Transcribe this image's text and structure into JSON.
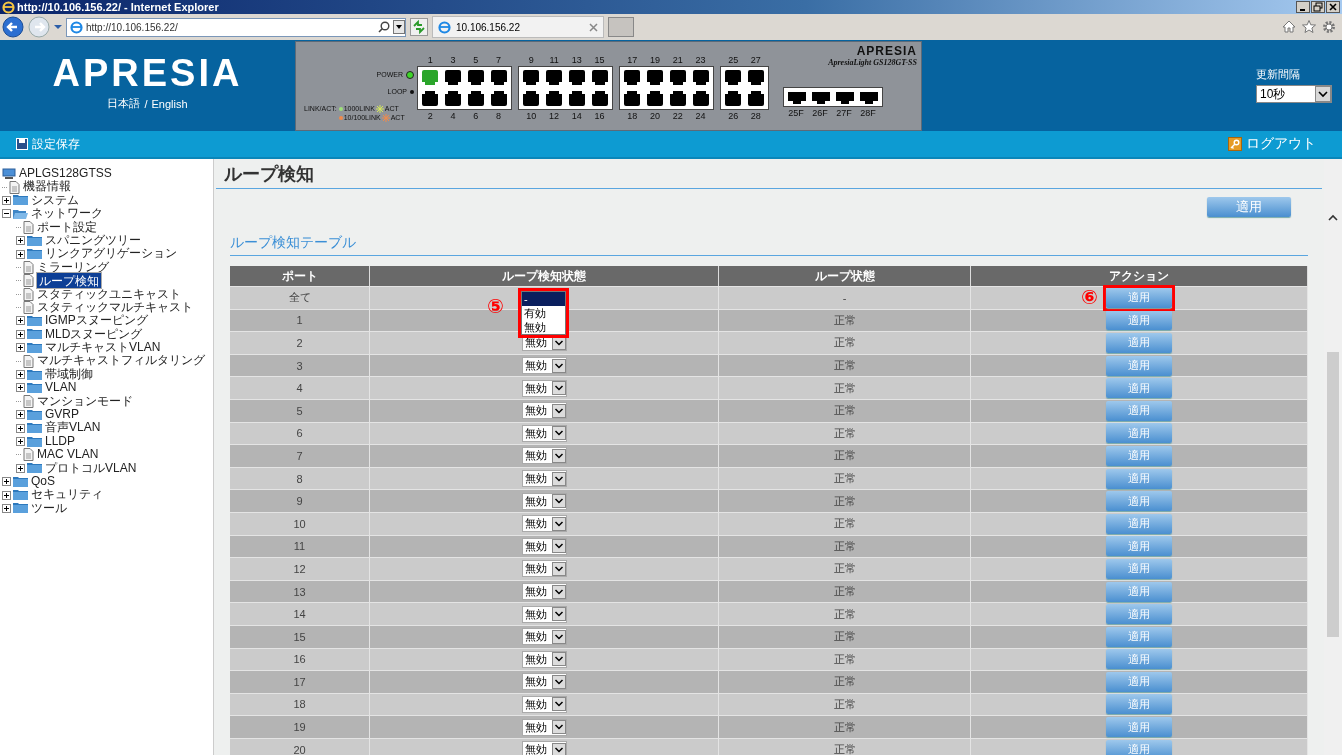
{
  "browser": {
    "title": "http://10.106.156.22/ - Internet Explorer",
    "address": "http://10.106.156.22/",
    "tab_title": "10.106.156.22"
  },
  "header": {
    "logo": "APRESIA",
    "languages": [
      "日本語",
      "English"
    ],
    "separator": "/",
    "switch": {
      "brand": "APRESIA",
      "model": "ApresiaLight GS128GT-SS",
      "leds": [
        {
          "label": "POWER",
          "color": "#3fd62a"
        },
        {
          "label": "LOOP",
          "color": "#111111"
        }
      ],
      "legend_title": "LINK/ACT:",
      "legend_rows": [
        [
          {
            "label": "1000LINK",
            "kind": "dot",
            "color": "#9ee27a"
          },
          {
            "label": "ACT",
            "kind": "burst",
            "color": "#d6e85a"
          }
        ],
        [
          {
            "label": "10/100LINK",
            "kind": "dot",
            "color": "#f08a4b"
          },
          {
            "label": "ACT",
            "kind": "burst",
            "color": "#f08a4b"
          }
        ]
      ],
      "port_groups": [
        {
          "columns": [
            {
              "upper": {
                "label": "1",
                "linked": true
              },
              "lower": {
                "label": "2",
                "linked": false
              }
            },
            {
              "upper": {
                "label": "3",
                "linked": false
              },
              "lower": {
                "label": "4",
                "linked": false
              }
            },
            {
              "upper": {
                "label": "5",
                "linked": false
              },
              "lower": {
                "label": "6",
                "linked": false
              }
            },
            {
              "upper": {
                "label": "7",
                "linked": false
              },
              "lower": {
                "label": "8",
                "linked": false
              }
            }
          ]
        },
        {
          "columns": [
            {
              "upper": {
                "label": "9",
                "linked": false
              },
              "lower": {
                "label": "10",
                "linked": false
              }
            },
            {
              "upper": {
                "label": "11",
                "linked": false
              },
              "lower": {
                "label": "12",
                "linked": false
              }
            },
            {
              "upper": {
                "label": "13",
                "linked": false
              },
              "lower": {
                "label": "14",
                "linked": false
              }
            },
            {
              "upper": {
                "label": "15",
                "linked": false
              },
              "lower": {
                "label": "16",
                "linked": false
              }
            }
          ]
        },
        {
          "columns": [
            {
              "upper": {
                "label": "17",
                "linked": false
              },
              "lower": {
                "label": "18",
                "linked": false
              }
            },
            {
              "upper": {
                "label": "19",
                "linked": false
              },
              "lower": {
                "label": "20",
                "linked": false
              }
            },
            {
              "upper": {
                "label": "21",
                "linked": false
              },
              "lower": {
                "label": "22",
                "linked": false
              }
            },
            {
              "upper": {
                "label": "23",
                "linked": false
              },
              "lower": {
                "label": "24",
                "linked": false
              }
            }
          ]
        },
        {
          "columns": [
            {
              "upper": {
                "label": "25",
                "linked": false
              },
              "lower": {
                "label": "26",
                "linked": false
              }
            },
            {
              "upper": {
                "label": "27",
                "linked": false
              },
              "lower": {
                "label": "28",
                "linked": false
              }
            }
          ]
        }
      ],
      "sfp_ports": [
        {
          "label": "25F",
          "linked": false
        },
        {
          "label": "26F",
          "linked": false
        },
        {
          "label": "27F",
          "linked": false
        },
        {
          "label": "28F",
          "linked": false
        }
      ]
    },
    "refresh": {
      "label": "更新間隔",
      "value": "10秒"
    }
  },
  "toolbar": {
    "save": "設定保存",
    "logout": "ログアウト"
  },
  "tree": {
    "label": "APLGS128GTSS",
    "children": [
      {
        "label": "機器情報",
        "kind": "page",
        "selected": false
      },
      {
        "label": "システム",
        "kind": "folder",
        "expanded": false,
        "selected": false
      },
      {
        "label": "ネットワーク",
        "kind": "folder",
        "expanded": true,
        "selected": false,
        "children": [
          {
            "label": "ポート設定",
            "kind": "page",
            "selected": false
          },
          {
            "label": "スパニングツリー",
            "kind": "folder",
            "expanded": false,
            "selected": false
          },
          {
            "label": "リンクアグリゲーション",
            "kind": "folder",
            "expanded": false,
            "selected": false
          },
          {
            "label": "ミラーリング",
            "kind": "page",
            "selected": false
          },
          {
            "label": "ループ検知",
            "kind": "page",
            "selected": true
          },
          {
            "label": "スタティックユニキャスト",
            "kind": "page",
            "selected": false
          },
          {
            "label": "スタティックマルチキャスト",
            "kind": "page",
            "selected": false
          },
          {
            "label": "IGMPスヌーピング",
            "kind": "folder",
            "expanded": false,
            "selected": false
          },
          {
            "label": "MLDスヌーピング",
            "kind": "folder",
            "expanded": false,
            "selected": false
          },
          {
            "label": "マルチキャストVLAN",
            "kind": "folder",
            "expanded": false,
            "selected": false
          },
          {
            "label": "マルチキャストフィルタリング",
            "kind": "page",
            "selected": false
          },
          {
            "label": "帯域制御",
            "kind": "folder",
            "expanded": false,
            "selected": false
          },
          {
            "label": "VLAN",
            "kind": "folder",
            "expanded": false,
            "selected": false
          },
          {
            "label": "マンションモード",
            "kind": "page",
            "selected": false
          },
          {
            "label": "GVRP",
            "kind": "folder",
            "expanded": false,
            "selected": false
          },
          {
            "label": "音声VLAN",
            "kind": "folder",
            "expanded": false,
            "selected": false
          },
          {
            "label": "LLDP",
            "kind": "folder",
            "expanded": false,
            "selected": false
          },
          {
            "label": "MAC VLAN",
            "kind": "page",
            "selected": false
          },
          {
            "label": "プロトコルVLAN",
            "kind": "folder",
            "expanded": false,
            "selected": false
          }
        ]
      },
      {
        "label": "QoS",
        "kind": "folder",
        "expanded": false,
        "selected": false
      },
      {
        "label": "セキュリティ",
        "kind": "folder",
        "expanded": false,
        "selected": false
      },
      {
        "label": "ツール",
        "kind": "folder",
        "expanded": false,
        "selected": false
      }
    ]
  },
  "page": {
    "title": "ループ検知",
    "apply": "適用",
    "section_title": "ループ検知テーブル",
    "table": {
      "columns": [
        "ポート",
        "ループ検知状態",
        "ループ状態",
        "アクション"
      ],
      "rows": [
        {
          "port": "全て",
          "select": {
            "annotation": "⑤",
            "options": [
              {
                "label": "-",
                "selected": true
              },
              {
                "label": "有効",
                "selected": false
              },
              {
                "label": "無効",
                "selected": false
              }
            ]
          },
          "loop_state": "-",
          "action": {
            "label": "適用",
            "annotation": "⑥"
          }
        },
        {
          "port": "1",
          "loop_state": "正常",
          "action": {
            "label": "適用"
          }
        },
        {
          "port": "2",
          "select": {
            "value": "無効"
          },
          "loop_state": "正常",
          "action": {
            "label": "適用"
          }
        },
        {
          "port": "3",
          "select": {
            "value": "無効"
          },
          "loop_state": "正常",
          "action": {
            "label": "適用"
          }
        },
        {
          "port": "4",
          "select": {
            "value": "無効"
          },
          "loop_state": "正常",
          "action": {
            "label": "適用"
          }
        },
        {
          "port": "5",
          "select": {
            "value": "無効"
          },
          "loop_state": "正常",
          "action": {
            "label": "適用"
          }
        },
        {
          "port": "6",
          "select": {
            "value": "無効"
          },
          "loop_state": "正常",
          "action": {
            "label": "適用"
          }
        },
        {
          "port": "7",
          "select": {
            "value": "無効"
          },
          "loop_state": "正常",
          "action": {
            "label": "適用"
          }
        },
        {
          "port": "8",
          "select": {
            "value": "無効"
          },
          "loop_state": "正常",
          "action": {
            "label": "適用"
          }
        },
        {
          "port": "9",
          "select": {
            "value": "無効"
          },
          "loop_state": "正常",
          "action": {
            "label": "適用"
          }
        },
        {
          "port": "10",
          "select": {
            "value": "無効"
          },
          "loop_state": "正常",
          "action": {
            "label": "適用"
          }
        },
        {
          "port": "11",
          "select": {
            "value": "無効"
          },
          "loop_state": "正常",
          "action": {
            "label": "適用"
          }
        },
        {
          "port": "12",
          "select": {
            "value": "無効"
          },
          "loop_state": "正常",
          "action": {
            "label": "適用"
          }
        },
        {
          "port": "13",
          "select": {
            "value": "無効"
          },
          "loop_state": "正常",
          "action": {
            "label": "適用"
          }
        },
        {
          "port": "14",
          "select": {
            "value": "無効"
          },
          "loop_state": "正常",
          "action": {
            "label": "適用"
          }
        },
        {
          "port": "15",
          "select": {
            "value": "無効"
          },
          "loop_state": "正常",
          "action": {
            "label": "適用"
          }
        },
        {
          "port": "16",
          "select": {
            "value": "無効"
          },
          "loop_state": "正常",
          "action": {
            "label": "適用"
          }
        },
        {
          "port": "17",
          "select": {
            "value": "無効"
          },
          "loop_state": "正常",
          "action": {
            "label": "適用"
          }
        },
        {
          "port": "18",
          "select": {
            "value": "無効"
          },
          "loop_state": "正常",
          "action": {
            "label": "適用"
          }
        },
        {
          "port": "19",
          "select": {
            "value": "無効"
          },
          "loop_state": "正常",
          "action": {
            "label": "適用"
          }
        },
        {
          "port": "20",
          "select": {
            "value": "無効"
          },
          "loop_state": "正常",
          "action": {
            "label": "適用"
          }
        }
      ]
    }
  }
}
